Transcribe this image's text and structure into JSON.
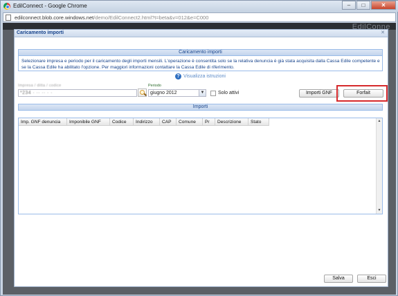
{
  "window": {
    "title": "EdilConnect - Google Chrome"
  },
  "controls": {
    "minimize": "–",
    "maximize": "□",
    "close": "✕"
  },
  "address": {
    "host": "edilconnect.blob.core.windows.net",
    "path": "/demo/EdilConnect2.html?t=beta&v=012&e=C000"
  },
  "page": {
    "brand": "EdilConne"
  },
  "dialog": {
    "title": "Caricamento importi",
    "close": "✕",
    "section_title": "Caricamento importi",
    "info": "Selezionare impresa e periodo per il caricamento degli importi mensili. L'operazione è consentita solo se la relativa denuncia è già stata acquisita dalla Cassa Edile competente e se la Cassa Edile ha abilitato l'opzione. Per maggiori informazioni contattare la Cassa Edile di riferimento.",
    "help_link": "Visualizza istruzioni"
  },
  "form": {
    "impresa_label": "Impresa / ditta / codice",
    "impresa_value": "*234 · ·· ·· · ·",
    "periodo_label": "Periodo",
    "periodo_value": "giugno 2012",
    "solo_attivi": "Solo attivi"
  },
  "buttons": {
    "importi_gnf": "Importi GNF",
    "forfait": "Forfait",
    "salva": "Salva",
    "esci": "Esci"
  },
  "grid": {
    "section_title": "Importi",
    "columns": [
      "Imp. GNF denuncia",
      "Imponibile GNF",
      "Codice",
      "Indirizzo",
      "CAP",
      "Comune",
      "Pr",
      "Descrizione",
      "Stato"
    ]
  },
  "icons": {
    "app": "chrome-icon",
    "search": "magnifier-icon",
    "help": "help-icon"
  },
  "colors": {
    "accent": "#15428b",
    "highlight": "#d6282b",
    "header_blue": "#99bbe8"
  }
}
